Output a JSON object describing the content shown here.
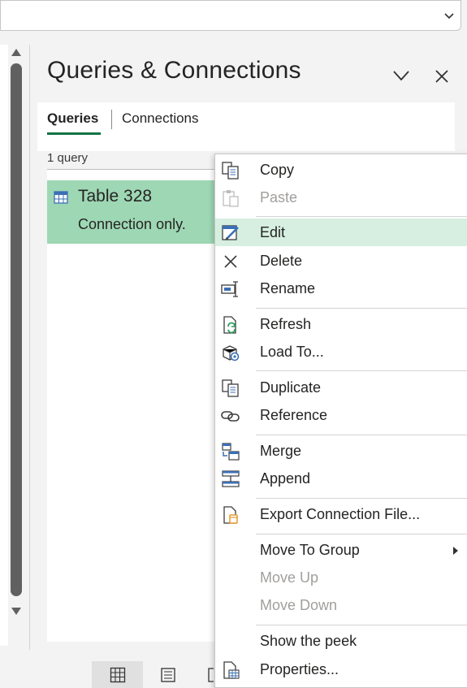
{
  "pane": {
    "title": "Queries & Connections",
    "tabs": [
      {
        "label": "Queries",
        "active": true
      },
      {
        "label": "Connections",
        "active": false
      }
    ],
    "query_count": "1 query",
    "queries": [
      {
        "name": "Table 328",
        "status": "Connection only."
      }
    ]
  },
  "context_menu": {
    "items": [
      {
        "label": "Copy",
        "icon": "copy-icon",
        "enabled": true
      },
      {
        "label": "Paste",
        "icon": "paste-icon",
        "enabled": false
      },
      {
        "label": "Edit",
        "icon": "edit-icon",
        "enabled": true,
        "highlighted": true
      },
      {
        "label": "Delete",
        "icon": "delete-icon",
        "enabled": true
      },
      {
        "label": "Rename",
        "icon": "rename-icon",
        "enabled": true
      },
      {
        "label": "Refresh",
        "icon": "refresh-icon",
        "enabled": true
      },
      {
        "label": "Load To...",
        "icon": "load-to-icon",
        "enabled": true
      },
      {
        "label": "Duplicate",
        "icon": "duplicate-icon",
        "enabled": true
      },
      {
        "label": "Reference",
        "icon": "reference-icon",
        "enabled": true
      },
      {
        "label": "Merge",
        "icon": "merge-icon",
        "enabled": true
      },
      {
        "label": "Append",
        "icon": "append-icon",
        "enabled": true
      },
      {
        "label": "Export Connection File...",
        "icon": "export-connection-icon",
        "enabled": true
      },
      {
        "label": "Move To Group",
        "icon": "",
        "enabled": true,
        "submenu": true
      },
      {
        "label": "Move Up",
        "icon": "",
        "enabled": false
      },
      {
        "label": "Move Down",
        "icon": "",
        "enabled": false
      },
      {
        "label": "Show the peek",
        "icon": "",
        "enabled": true
      },
      {
        "label": "Properties...",
        "icon": "properties-icon",
        "enabled": true
      }
    ]
  },
  "status_bar": {
    "views": [
      "normal-view-icon",
      "page-layout-view-icon",
      "page-break-view-icon"
    ],
    "active_view": "normal-view-icon"
  },
  "colors": {
    "accent": "#127346",
    "selected_query_bg": "#9ed7b4",
    "menu_highlight": "#d6efe0"
  }
}
